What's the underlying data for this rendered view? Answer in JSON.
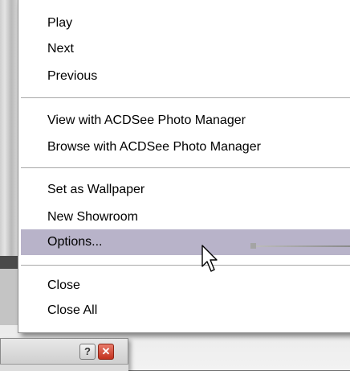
{
  "menu": {
    "items": [
      {
        "label": "Play"
      },
      {
        "label": "Next"
      },
      {
        "label": "Previous"
      },
      {
        "label": "View with ACDSee Photo Manager"
      },
      {
        "label": "Browse with ACDSee Photo Manager"
      },
      {
        "label": "Set as Wallpaper"
      },
      {
        "label": "New Showroom"
      },
      {
        "label": "Options..."
      },
      {
        "label": "Close"
      },
      {
        "label": "Close All"
      }
    ],
    "highlighted_item": "Options...",
    "highlight_color": "#b8b3c9"
  },
  "dialog": {
    "help_label": "?",
    "close_label": "✕",
    "close_color": "#c2311e"
  },
  "icons": {
    "cursor": "arrow-cursor-icon"
  }
}
